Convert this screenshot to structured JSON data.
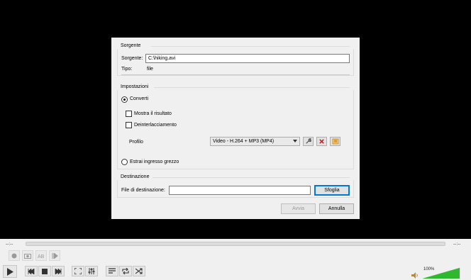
{
  "dialog": {
    "source_group": "Sorgente",
    "source_label": "Sorgente:",
    "source_value": "C:\\hiking.avi",
    "type_label": "Tipo:",
    "type_value": "file",
    "settings_group": "Impostazioni",
    "convert_label": "Converti",
    "show_output_label": "Mostra il risultato",
    "deinterlace_label": "Deinterlacciamento",
    "profile_label": "Profilo",
    "profile_selected": "Video - H.264 + MP3 (MP4)",
    "raw_input_label": "Estrai ingresso grezzo",
    "destination_group": "Destinazione",
    "dest_file_label": "File di destinazione:",
    "dest_file_value": "",
    "browse_button": "Sfoglia",
    "start_button": "Avvia",
    "cancel_button": "Annulla"
  },
  "player": {
    "time_elapsed": "--:--",
    "time_total": "--:--",
    "volume_percent": "100%"
  },
  "colors": {
    "delete_icon": "#d42020",
    "volume_fill": "#2eb82e",
    "primary_border": "#0078d7"
  }
}
